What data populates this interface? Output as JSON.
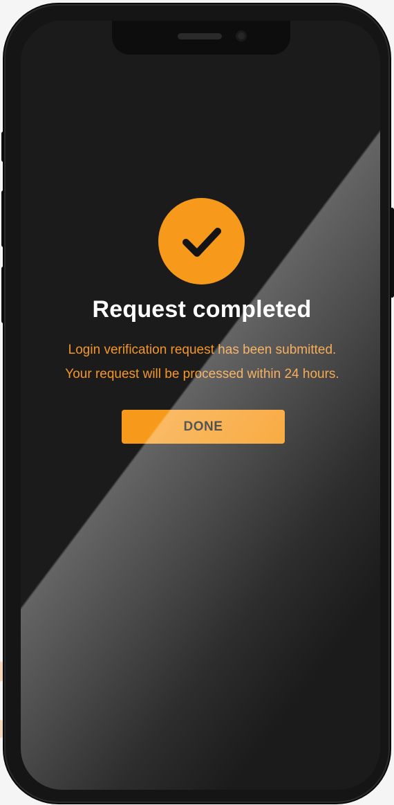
{
  "dialog": {
    "title": "Request completed",
    "message_line_1": "Login verification request has been submitted.",
    "message_line_2": "Your request will be processed within 24 hours.",
    "done_label": "DONE",
    "icon": "checkmark-icon"
  },
  "colors": {
    "accent": "#f7991a",
    "screen_background": "#1b1b1b",
    "title_text": "#ffffff",
    "message_text": "#f5962a",
    "button_text": "#111111"
  }
}
